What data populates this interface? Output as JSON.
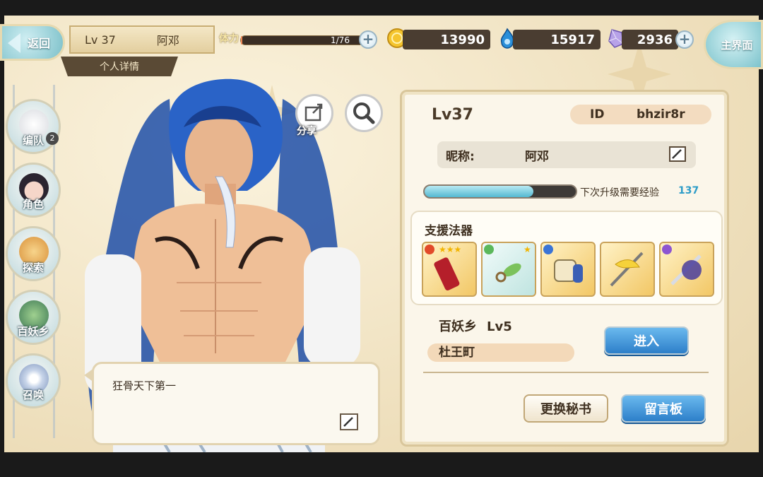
{
  "nav": {
    "back_label": "返回",
    "home_label": "主界面"
  },
  "player": {
    "level": "Lv 37",
    "name": "阿邓",
    "tab_label": "个人详情"
  },
  "stamina": {
    "label": "体力",
    "value": "1/76",
    "fill_fraction": 0.013
  },
  "resources": {
    "coins": {
      "icon": "gold-coin-icon",
      "value": "13990",
      "color": "#f2c230"
    },
    "souls": {
      "icon": "blue-flame-icon",
      "value": "15917",
      "color": "#2a8fd9"
    },
    "crystals": {
      "icon": "crystal-icon",
      "value": "2936",
      "color": "#b7a2e8"
    }
  },
  "sidebar": {
    "items": [
      {
        "label": "编队",
        "icon": "team-formation-icon",
        "badge": "2"
      },
      {
        "label": "角色",
        "icon": "character-icon"
      },
      {
        "label": "探索",
        "icon": "explore-icon"
      },
      {
        "label": "百妖乡",
        "icon": "village-icon"
      },
      {
        "label": "召唤",
        "icon": "summon-icon"
      }
    ]
  },
  "actions": {
    "share_label": "分享"
  },
  "speech": {
    "text": "狂骨天下第一"
  },
  "profile": {
    "level": "Lv37",
    "id_label": "ID",
    "id_value": "bhzir8r",
    "nickname_label": "昵称:",
    "nickname_value": "阿邓",
    "xp_label": "下次升级需要经验",
    "xp_value": "137",
    "xp_fill_fraction": 0.72,
    "support_title": "支援法器",
    "support_items": [
      {
        "name": "red-scroll-item",
        "stars": "★★★"
      },
      {
        "name": "leaf-charm-item",
        "stars": "★"
      },
      {
        "name": "paper-scroll-item",
        "stars": ""
      },
      {
        "name": "golden-feather-blade-item",
        "stars": ""
      },
      {
        "name": "purple-sword-item",
        "stars": ""
      }
    ],
    "village_name": "百妖乡",
    "village_level": "Lv5",
    "town_name": "杜王町",
    "enter_label": "进入",
    "change_secretary_label": "更换秘书",
    "message_board_label": "留言板"
  },
  "colors": {
    "accent_blue": "#2d7fc9",
    "panel_border": "#d9c69b",
    "parchment": "#f2e5c6"
  }
}
